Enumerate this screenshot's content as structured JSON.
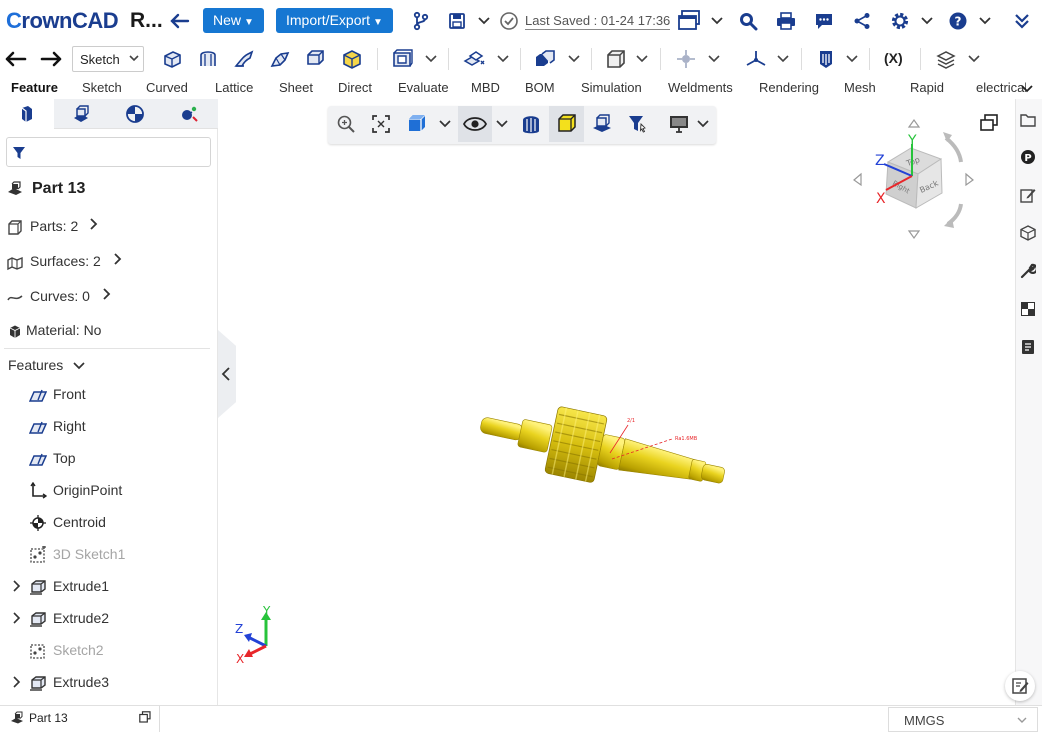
{
  "header": {
    "logo_c": "C",
    "logo_rest": "rownCAD",
    "doc_title": "R...",
    "new_label": "New",
    "import_export_label": "Import/Export",
    "last_saved": "Last Saved : 01-24 17:36"
  },
  "toolbar": {
    "sketch_select": "Sketch",
    "fx_label": "(X)"
  },
  "tabs": [
    "Feature",
    "Sketch",
    "Curved",
    "Lattice",
    "Sheet",
    "Direct",
    "Evaluate",
    "MBD",
    "BOM",
    "Simulation",
    "Weldments",
    "Rendering",
    "Mesh",
    "Rapid",
    "electrical"
  ],
  "left_panel": {
    "part_title": "Part 13",
    "parts": "Parts: 2",
    "surfaces": "Surfaces: 2",
    "curves": "Curves: 0",
    "material": "Material: No",
    "features_header": "Features",
    "features": [
      {
        "label": "Front",
        "icon": "plane-icon"
      },
      {
        "label": "Right",
        "icon": "plane-icon"
      },
      {
        "label": "Top",
        "icon": "plane-icon"
      },
      {
        "label": "OriginPoint",
        "icon": "origin-icon"
      },
      {
        "label": "Centroid",
        "icon": "centroid-icon"
      },
      {
        "label": "3D Sketch1",
        "icon": "sketch-icon"
      },
      {
        "label": "Extrude1",
        "icon": "extrude-icon"
      },
      {
        "label": "Extrude2",
        "icon": "extrude-icon"
      },
      {
        "label": "Sketch2",
        "icon": "sketch-icon"
      },
      {
        "label": "Extrude3",
        "icon": "extrude-icon"
      }
    ]
  },
  "viewcube": {
    "face_top": "Top",
    "face_front": "Back",
    "face_left": "Right"
  },
  "axes": {
    "x": "X",
    "y": "Y",
    "z": "Z"
  },
  "model_annotations": {
    "a1": "2/1",
    "a2": "Ra1.6MB"
  },
  "bottom": {
    "part_tab": "Part 13",
    "units": "MMGS"
  },
  "colors": {
    "accent": "#1677d2",
    "model": "#e7d31a",
    "x_axis": "#e8262a",
    "y_axis": "#27c33b",
    "z_axis": "#2342d6"
  }
}
